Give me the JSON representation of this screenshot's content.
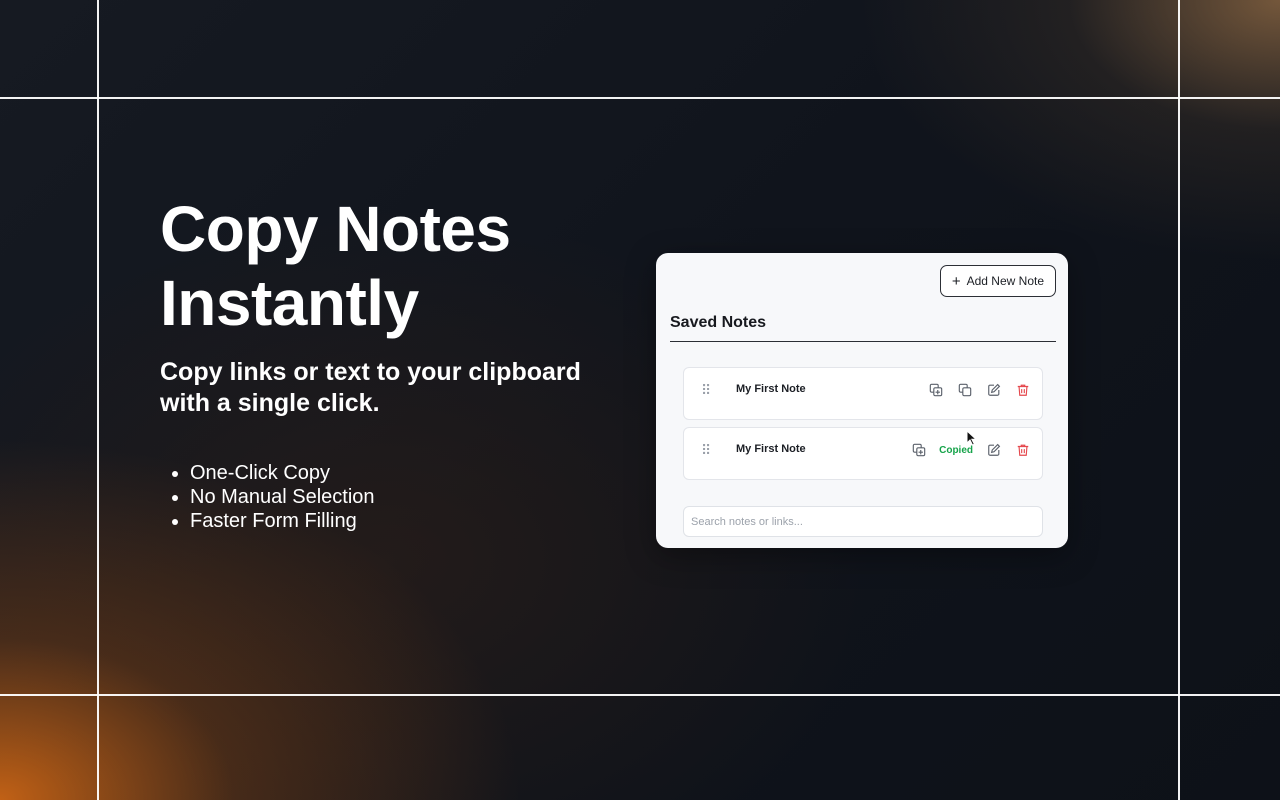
{
  "hero": {
    "headline": "Copy Notes Instantly",
    "subheadline": "Copy links or text to your clipboard with a single click.",
    "features": [
      "One-Click Copy",
      "No Manual Selection",
      "Faster Form Filling"
    ]
  },
  "panel": {
    "add_button_label": "Add New Note",
    "section_title": "Saved Notes",
    "notes": [
      {
        "title": "My First Note",
        "status": ""
      },
      {
        "title": "My First Note",
        "status": "Copied"
      }
    ],
    "search_placeholder": "Search notes or links..."
  },
  "colors": {
    "copied_status": "#16a34a",
    "delete_icon": "#e5484d",
    "accent_orange": "#e06e14"
  },
  "icons": [
    "plus-icon",
    "drag-handle-icon",
    "duplicate-icon",
    "copy-icon",
    "edit-icon",
    "trash-icon",
    "mouse-cursor-icon"
  ]
}
